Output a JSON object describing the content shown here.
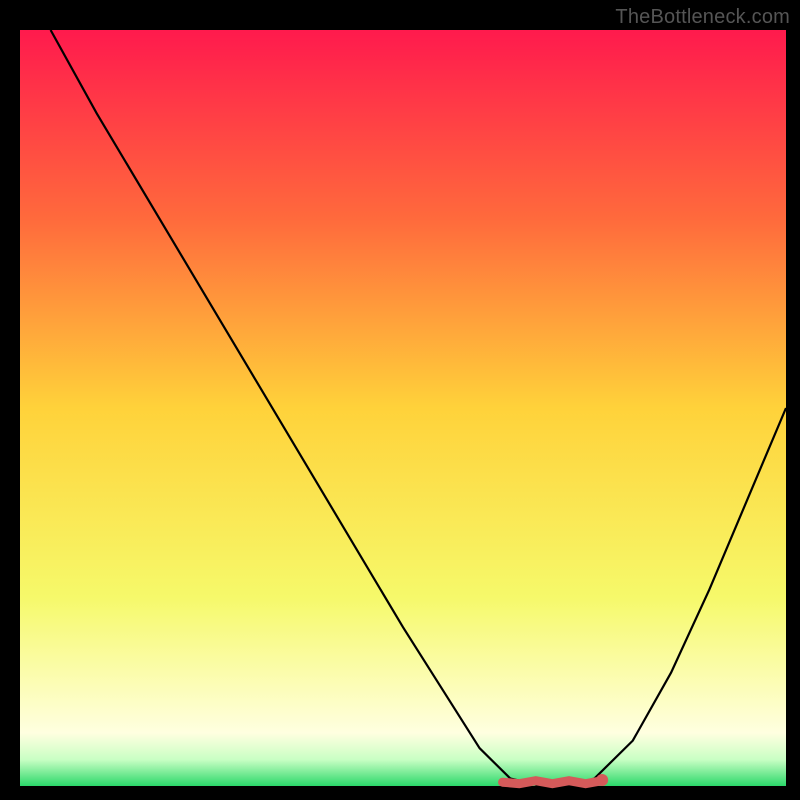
{
  "watermark": "TheBottleneck.com",
  "chart_data": {
    "type": "line",
    "title": "",
    "xlabel": "",
    "ylabel": "",
    "xlim": [
      0,
      100
    ],
    "ylim": [
      0,
      100
    ],
    "grid": false,
    "legend": false,
    "background_gradient": {
      "stops": [
        {
          "pos": 0.0,
          "color": "#ff1a4d"
        },
        {
          "pos": 0.25,
          "color": "#ff6a3c"
        },
        {
          "pos": 0.5,
          "color": "#ffd23a"
        },
        {
          "pos": 0.75,
          "color": "#f6f96a"
        },
        {
          "pos": 0.93,
          "color": "#ffffe0"
        },
        {
          "pos": 0.965,
          "color": "#c9ffc4"
        },
        {
          "pos": 1.0,
          "color": "#2bd86a"
        }
      ]
    },
    "series": [
      {
        "name": "bottleneck-curve",
        "color": "#000000",
        "x": [
          4,
          10,
          20,
          30,
          40,
          50,
          55,
          60,
          64,
          68,
          72,
          75,
          80,
          85,
          90,
          95,
          100
        ],
        "y": [
          100,
          89,
          72,
          55,
          38,
          21,
          13,
          5,
          1,
          0,
          0,
          1,
          6,
          15,
          26,
          38,
          50
        ]
      }
    ],
    "marker": {
      "name": "trough-segment",
      "color": "#d45a5a",
      "x_range": [
        63,
        76
      ],
      "y": 0.5,
      "end_dot": {
        "x": 76,
        "y": 0.8
      }
    }
  }
}
